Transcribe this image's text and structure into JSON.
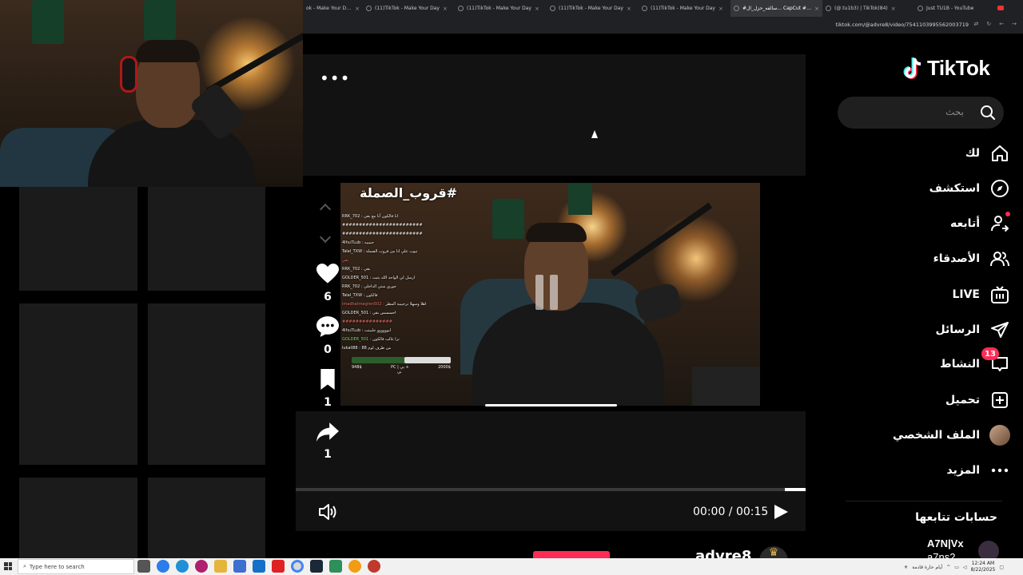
{
  "browser": {
    "tabs": [
      {
        "label": "ok - Make Your Day",
        "active": false
      },
      {
        "label": "(11)TikTok - Make Your Day",
        "active": false
      },
      {
        "label": "(11)TikTok - Make Your Day",
        "active": false
      },
      {
        "label": "(11)TikTok - Make Your Day",
        "active": false
      },
      {
        "label": "(11)TikTok - Make Your Day",
        "active": false
      },
      {
        "label": "#سالفه_حزل_ال... CapCut #c8#",
        "active": true
      },
      {
        "label": "(@.tu1b3) | TikTok(84)",
        "active": false
      },
      {
        "label": "Just TU1B - YouTube",
        "active": false
      }
    ],
    "url": "tiktok.com/@advre8/video/7541103995562003719"
  },
  "tiktok": {
    "logo": "TikTok",
    "search_placeholder": "بحث",
    "nav": [
      {
        "label": "لك",
        "icon": "home-icon"
      },
      {
        "label": "استكشف",
        "icon": "compass-icon"
      },
      {
        "label": "أتابعه",
        "icon": "following-icon"
      },
      {
        "label": "الأصدقاء",
        "icon": "friends-icon"
      },
      {
        "label": "LIVE",
        "icon": "live-icon"
      },
      {
        "label": "الرسائل",
        "icon": "send-icon"
      },
      {
        "label": "النشاط",
        "icon": "inbox-icon",
        "badge": "13"
      },
      {
        "label": "تحميل",
        "icon": "upload-icon"
      },
      {
        "label": "الملف الشخصي",
        "icon": "profile-avatar"
      },
      {
        "label": "المزيد",
        "icon": "more-icon"
      }
    ],
    "following_header": "حسابات تتابعها",
    "following_user": {
      "name": "A7N|Vx",
      "sub": "a7ns2"
    }
  },
  "video": {
    "overlay_title": "#قروب_الصملة",
    "chat": [
      {
        "user": "RRK_702",
        "text": "انا فالكون آنا مع بقي",
        "color": "w"
      },
      {
        "user": "",
        "text": "########################",
        "color": "w"
      },
      {
        "user": "",
        "text": "########################",
        "color": "w"
      },
      {
        "user": "4lhu7Lub",
        "text": "حبيبيه",
        "color": "w"
      },
      {
        "user": "Talal_TXW",
        "text": "تيوب علي انا من قروب الصملة",
        "color": "w"
      },
      {
        "user": "",
        "text": "بقي",
        "color": "r"
      },
      {
        "user": "",
        "text": "",
        "color": "r"
      },
      {
        "user": "RRK_702",
        "text": "بقي",
        "color": "w"
      },
      {
        "user": "GOLDER_501",
        "text": "ارسل لي الواحد الله يثبت",
        "color": "w"
      },
      {
        "user": "RRK_702",
        "text": "جوري ستي الداخلي",
        "color": "w"
      },
      {
        "user": "Talal_TXW",
        "text": "فالكون",
        "color": "w"
      },
      {
        "user": "imadhatmegren502",
        "text": "اهلا وسهلا ترحيبية المطر",
        "color": "r"
      },
      {
        "user": "GOLDER_501",
        "text": "احسسس بقي",
        "color": "w"
      },
      {
        "user": "",
        "text": "###############",
        "color": "r"
      },
      {
        "user": "4lhu7Lub",
        "text": "ابوووووو جلبيتت",
        "color": "w"
      },
      {
        "user": "GOLDER_501",
        "text": "ترا غالب فالكون",
        "color": "g"
      },
      {
        "user": "lukall88",
        "text": "من طرف لوم 88",
        "color": "w"
      }
    ],
    "goal": {
      "left": "948$",
      "mid": "PC | بي +",
      "right": "2000$",
      "sub": "بي",
      "progress": 0.47
    },
    "likes": "6",
    "comments": "0",
    "saves": "1",
    "shares": "1",
    "time": "00:00 / 00:15",
    "timeline_progress": 0.04,
    "author": "advre8"
  },
  "taskbar": {
    "search_placeholder": "Type here to search",
    "weather": "أيام حارة قادمة",
    "time": "12:24 AM",
    "date": "8/22/2025"
  }
}
